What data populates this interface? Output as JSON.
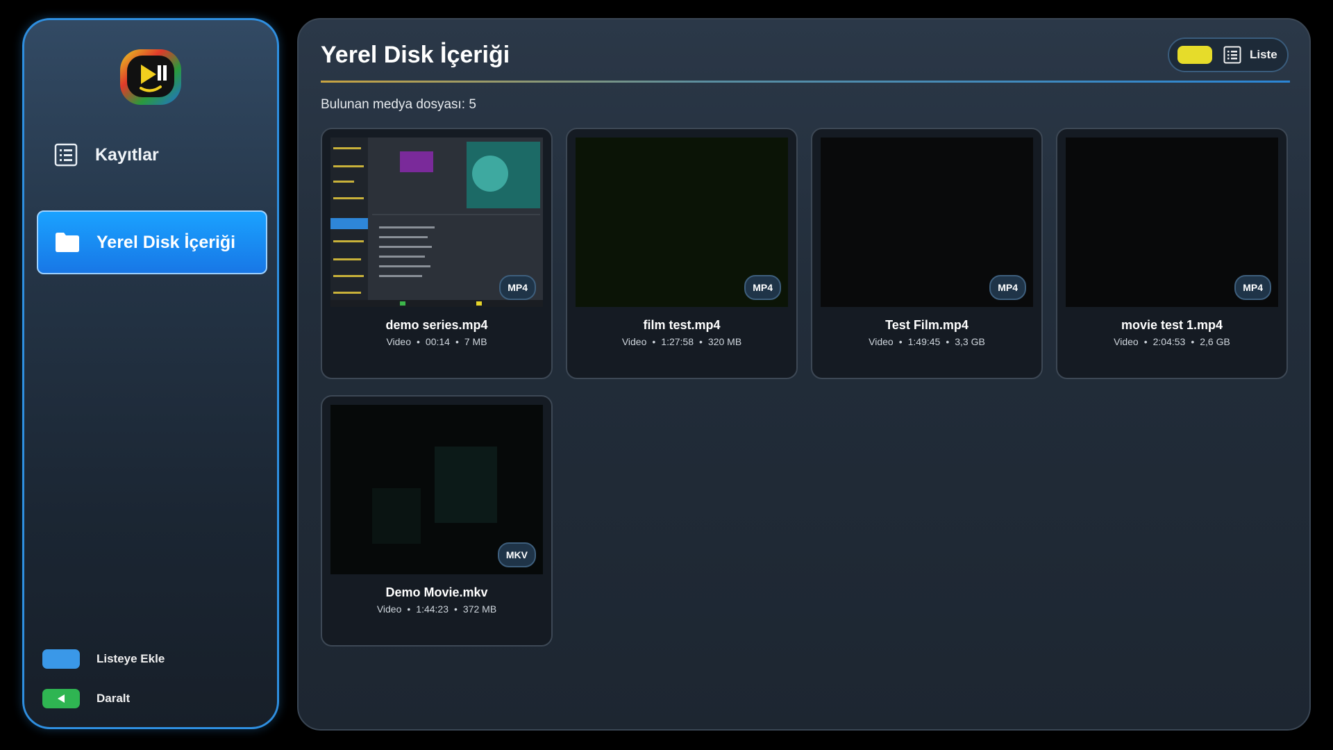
{
  "sidebar": {
    "items": [
      {
        "label": "Kayıtlar",
        "icon": "list-icon"
      },
      {
        "label": "Yerel Disk İçeriği",
        "icon": "folder-icon"
      }
    ],
    "legend": [
      {
        "label": "Listeye Ekle",
        "color": "#3a98e8"
      },
      {
        "label": "Daralt",
        "color": "#2fb552",
        "icon": "arrow-left-icon"
      }
    ]
  },
  "main": {
    "title": "Yerel Disk İçeriği",
    "view_toggle": {
      "label": "Liste",
      "key_color": "#e6dc2a"
    },
    "count_text": "Bulunan medya dosyası: 5",
    "files": [
      {
        "name": "demo series.mp4",
        "type": "Video",
        "duration": "00:14",
        "size": "7 MB",
        "format": "MP4"
      },
      {
        "name": "film test.mp4",
        "type": "Video",
        "duration": "1:27:58",
        "size": "320 MB",
        "format": "MP4"
      },
      {
        "name": "Test Film.mp4",
        "type": "Video",
        "duration": "1:49:45",
        "size": "3,3 GB",
        "format": "MP4"
      },
      {
        "name": "movie test 1.mp4",
        "type": "Video",
        "duration": "2:04:53",
        "size": "2,6 GB",
        "format": "MP4"
      },
      {
        "name": "Demo Movie.mkv",
        "type": "Video",
        "duration": "1:44:23",
        "size": "372 MB",
        "format": "MKV"
      }
    ]
  },
  "colors": {
    "accent": "#1a8cf0",
    "sidebar_border": "#2f8fe0"
  }
}
